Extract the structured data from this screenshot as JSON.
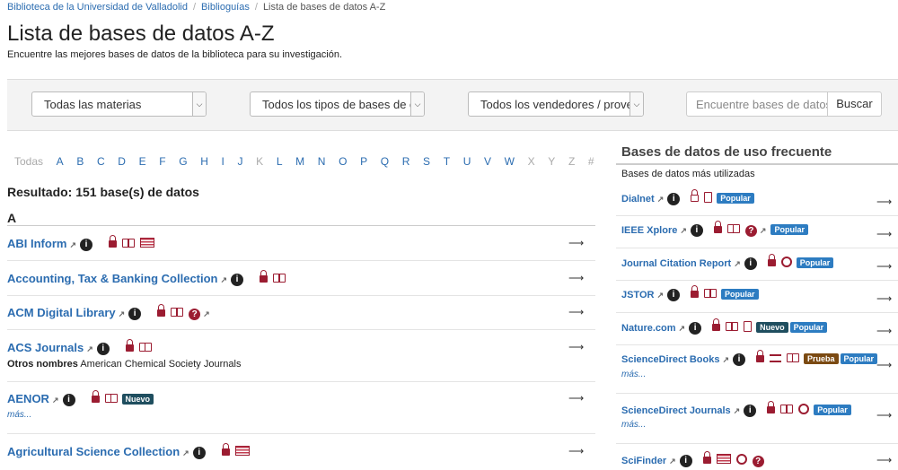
{
  "breadcrumb": {
    "items": [
      "Biblioteca de la Universidad de Valladolid",
      "Biblioguías",
      "Lista de bases de datos A-Z"
    ]
  },
  "page": {
    "title": "Lista de bases de datos A-Z",
    "subtitle": "Encuentre las mejores bases de datos de la biblioteca para su investigación."
  },
  "filters": {
    "subjects": "Todas las materias",
    "types": "Todos los tipos de bases de datos",
    "vendors": "Todos los vendedores / proveedores",
    "search_placeholder": "Encuentre bases de datos",
    "search_button": "Buscar"
  },
  "az": {
    "all": "Todas",
    "letters": [
      "A",
      "B",
      "C",
      "D",
      "E",
      "F",
      "G",
      "H",
      "I",
      "J",
      "K",
      "L",
      "M",
      "N",
      "O",
      "P",
      "Q",
      "R",
      "S",
      "T",
      "U",
      "V",
      "W",
      "X",
      "Y",
      "Z",
      "#"
    ]
  },
  "results": {
    "count_text": "Resultado: 151 base(s) de datos",
    "letter": "A",
    "rows": [
      {
        "name": "ABI Inform",
        "icons": [
          "lock-icon",
          "book-icon",
          "flag-icon"
        ]
      },
      {
        "name": "Accounting, Tax & Banking Collection",
        "icons": [
          "lock-icon",
          "book-icon"
        ]
      },
      {
        "name": "ACM Digital Library",
        "icons": [
          "lock-icon",
          "book-icon",
          "help-icon"
        ]
      },
      {
        "name": "ACS Journals",
        "icons": [
          "lock-icon",
          "book-icon"
        ],
        "alt_label": "Otros nombres",
        "alt_value": "American Chemical Society Journals"
      },
      {
        "name": "AENOR",
        "icons": [
          "lock-icon",
          "book-icon"
        ],
        "badge": "Nuevo",
        "more": "más..."
      },
      {
        "name": "Agricultural Science Collection",
        "icons": [
          "lock-icon",
          "flag-icon"
        ]
      }
    ]
  },
  "sidebar": {
    "title": "Bases de datos de uso frecuente",
    "subtitle": "Bases de datos más utilizadas",
    "badge_popular": "Popular",
    "badge_new": "Nuevo",
    "badge_trial": "Prueba",
    "more": "más...",
    "items": [
      {
        "name": "Dialnet"
      },
      {
        "name": "IEEE Xplore"
      },
      {
        "name": "Journal Citation Report"
      },
      {
        "name": "JSTOR"
      },
      {
        "name": "Nature.com"
      },
      {
        "name": "ScienceDirect Books"
      },
      {
        "name": "ScienceDirect Journals"
      },
      {
        "name": "SciFinder"
      }
    ]
  },
  "colors": {
    "link": "#2b6cb0",
    "accent": "#9b1c31",
    "popular": "#2d7cc1",
    "new": "#1f4e5f",
    "trial": "#7b4a12"
  }
}
